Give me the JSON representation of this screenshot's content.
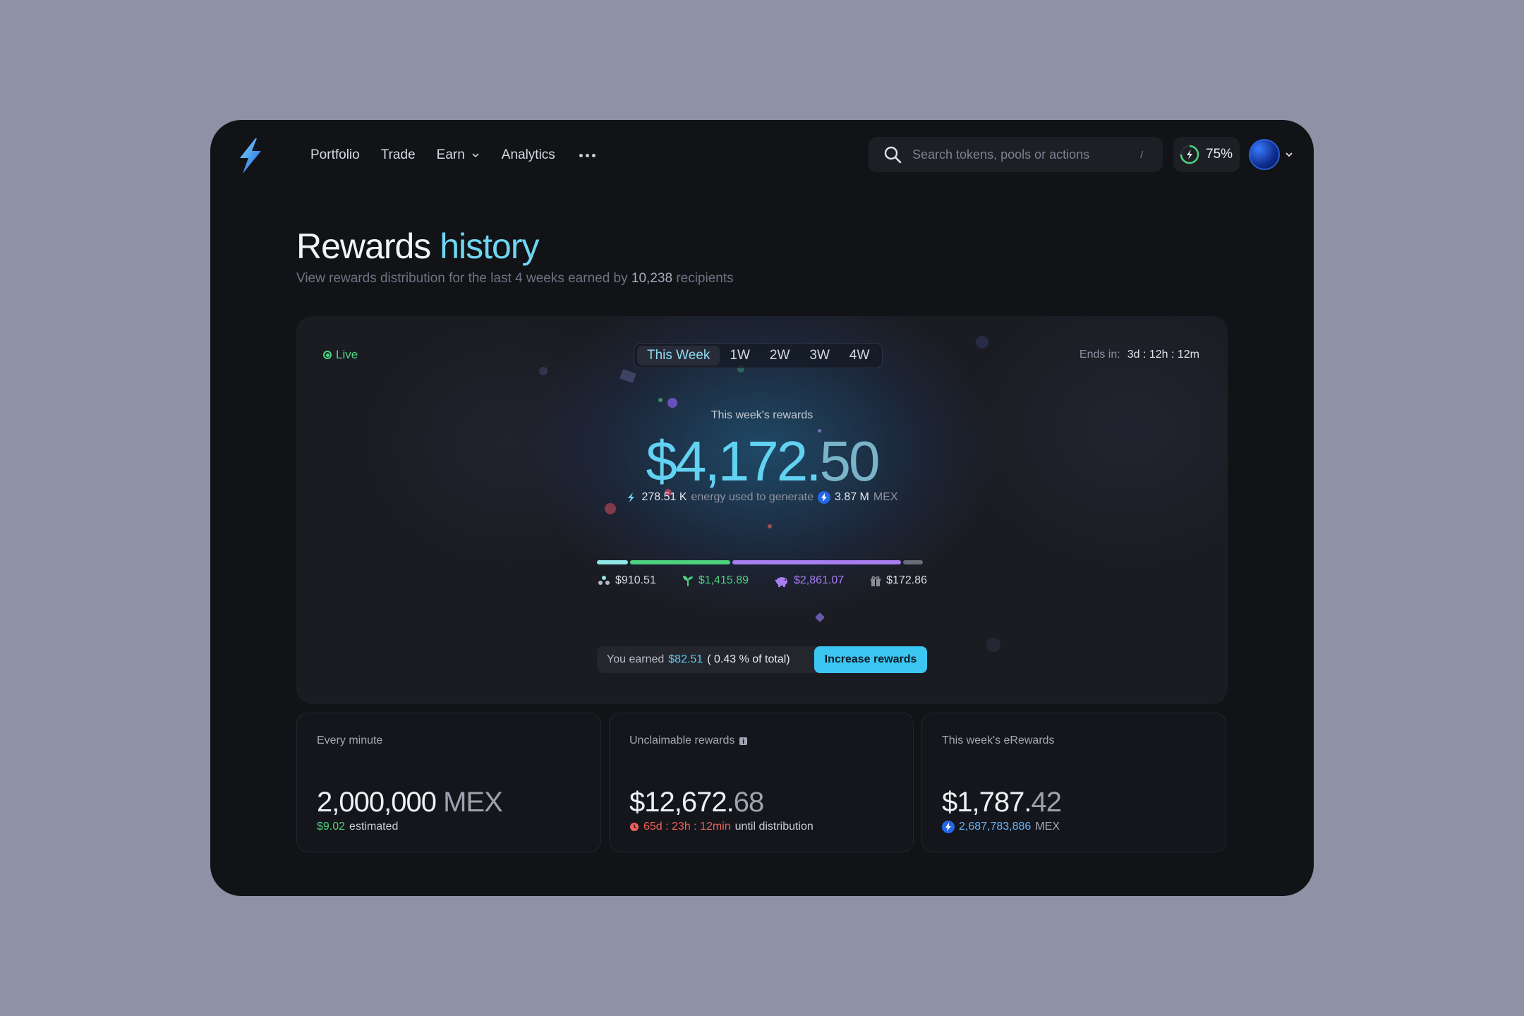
{
  "nav": {
    "items": [
      "Portfolio",
      "Trade",
      "Earn",
      "Analytics"
    ],
    "more_icon": "ellipsis-icon"
  },
  "search": {
    "placeholder": "Search tokens, pools or actions",
    "shortcut": "/"
  },
  "energy": {
    "value": "75%"
  },
  "page": {
    "title_main": "Rewards",
    "title_accent": "history",
    "subtitle_pre": "View rewards distribution for the last 4 weeks earned by",
    "subtitle_count": "10,238",
    "subtitle_post": "recipients"
  },
  "hero": {
    "live_label": "Live",
    "tabs": [
      "This Week",
      "1W",
      "2W",
      "3W",
      "4W"
    ],
    "active_tab": "This Week",
    "ends_label": "Ends in:",
    "ends_time": "3d : 12h : 12m",
    "rewards_label": "This week's rewards",
    "amount_main": "$4,172.",
    "amount_cents": "50",
    "energy_used": "278.51 K",
    "energy_text": "energy used to generate",
    "mex_amount": "3.87 M",
    "mex_unit": "MEX",
    "distribution": [
      {
        "label": "$910.51",
        "fraction": 0.095,
        "color": "#8fe6e6",
        "text_color": "#d8dbe3",
        "icon": "pool-icon"
      },
      {
        "label": "$1,415.89",
        "fraction": 0.31,
        "color": "#4ed17e",
        "text_color": "#4ed17e",
        "icon": "sprout-icon"
      },
      {
        "label": "$2,861.07",
        "fraction": 0.52,
        "color": "#a77df0",
        "text_color": "#a77df0",
        "icon": "piggy-bank-icon"
      },
      {
        "label": "$172.86",
        "fraction": 0.06,
        "color": "#6a6d78",
        "text_color": "#d8dbe3",
        "icon": "gift-icon"
      }
    ],
    "earned_label": "You earned",
    "earned_amount": "$82.51",
    "earned_share": "( 0.43 % of total)",
    "cta": "Increase rewards"
  },
  "cards": [
    {
      "label": "Every minute",
      "value_main": "2,000,000",
      "value_dim": " MEX",
      "sub_highlight": "$9.02",
      "sub_text": "estimated",
      "sub_color": "#4ed17e"
    },
    {
      "label": "Unclaimable rewards",
      "value_main": "$12,672.",
      "value_dim": "68",
      "sub_highlight": "65d : 23h : 12min",
      "sub_text": "until distribution",
      "sub_color": "#f0605a"
    },
    {
      "label": "This week's eRewards",
      "value_main": "$1,787.",
      "value_dim": "42",
      "sub_highlight": "2,687,783,886",
      "sub_text": "MEX",
      "sub_color": "#62b6ff"
    }
  ]
}
